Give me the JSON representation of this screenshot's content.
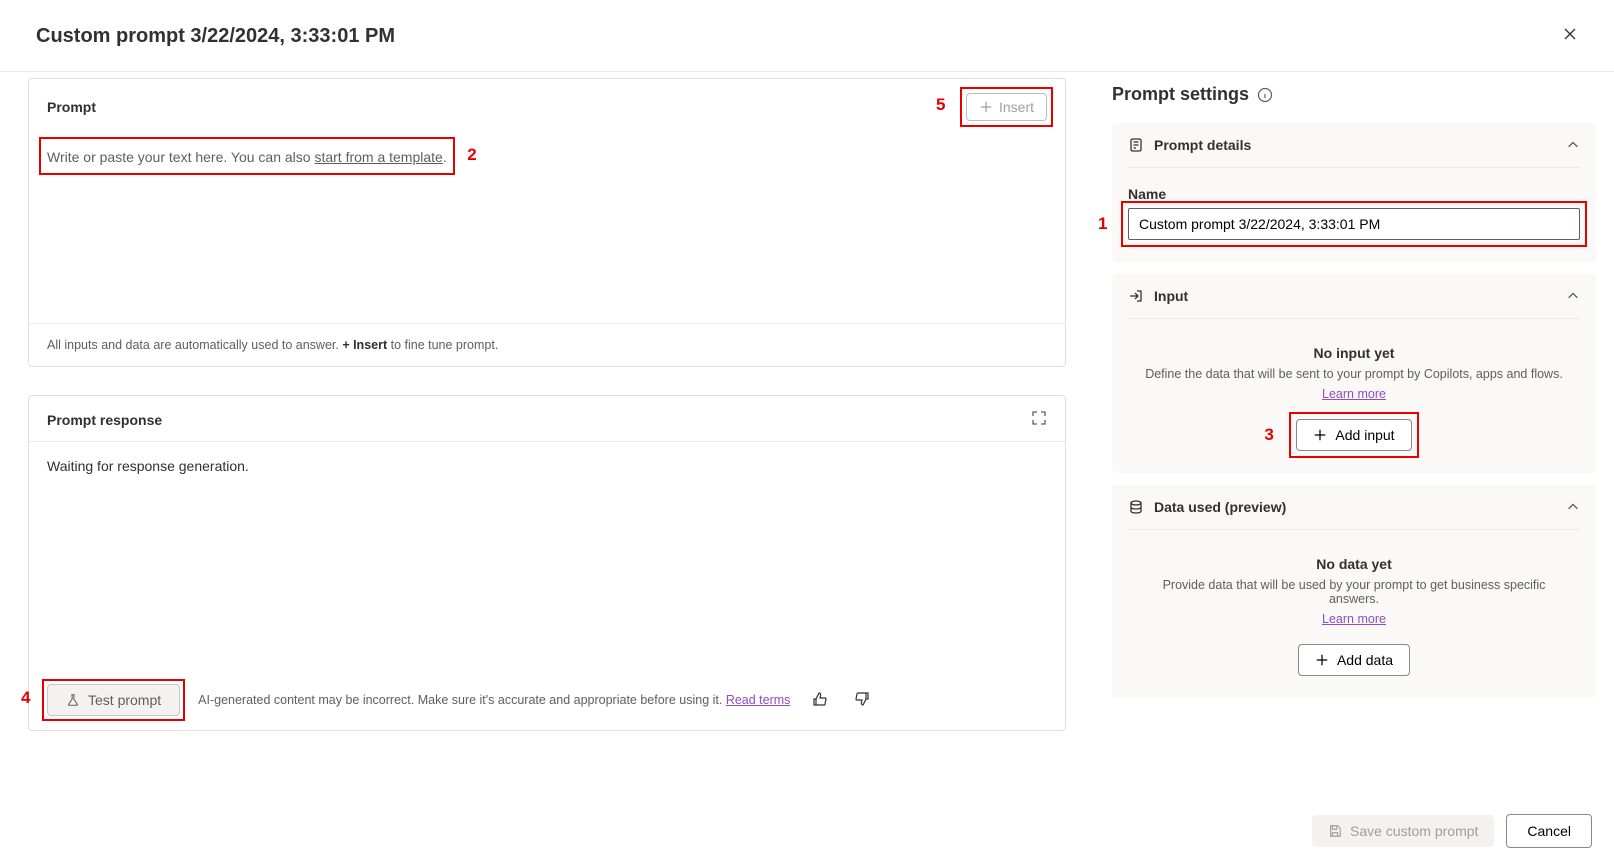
{
  "header": {
    "title": "Custom prompt 3/22/2024, 3:33:01 PM"
  },
  "prompt_card": {
    "title": "Prompt",
    "insert_label": "Insert",
    "placeholder_prefix": "Write or paste your text here. You can also ",
    "placeholder_link": "start from a template",
    "placeholder_suffix": ".",
    "hint_prefix": "All inputs and data are automatically used to answer. ",
    "hint_bold": "+ Insert",
    "hint_suffix": " to fine tune prompt."
  },
  "response_card": {
    "title": "Prompt response",
    "waiting_text": "Waiting for response generation.",
    "test_label": "Test prompt",
    "disclaimer_text": "AI-generated content may be incorrect. Make sure it's accurate and appropriate before using it. ",
    "read_terms": "Read terms"
  },
  "sidebar": {
    "title": "Prompt settings",
    "details": {
      "heading": "Prompt details",
      "name_label": "Name",
      "name_value": "Custom prompt 3/22/2024, 3:33:01 PM"
    },
    "input": {
      "heading": "Input",
      "empty_title": "No input yet",
      "empty_desc": "Define the data that will be sent to your prompt by Copilots, apps and flows.",
      "learn_more": "Learn more",
      "add_label": "Add input"
    },
    "data": {
      "heading": "Data used (preview)",
      "empty_title": "No data yet",
      "empty_desc": "Provide data that will be used by your prompt to get business specific answers.",
      "learn_more": "Learn more",
      "add_label": "Add data"
    }
  },
  "footer": {
    "save_label": "Save custom prompt",
    "cancel_label": "Cancel"
  },
  "annotations": {
    "n1": "1",
    "n2": "2",
    "n3": "3",
    "n4": "4",
    "n5": "5"
  }
}
